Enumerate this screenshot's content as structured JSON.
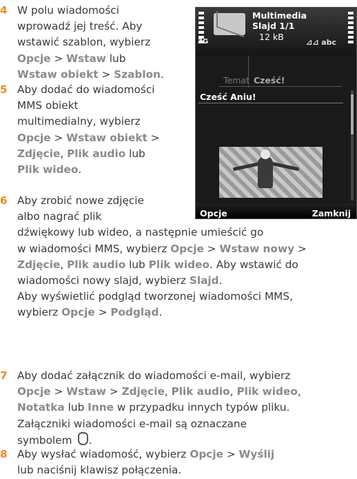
{
  "steps": [
    {
      "num": "4",
      "lines": [
        [
          "W polu wiadomości"
        ],
        [
          "wprowadź jej treść. Aby"
        ],
        [
          "wstawić szablon, wybierz"
        ],
        [
          {
            "b": "Opcje"
          },
          " > ",
          {
            "b": "Wstaw"
          },
          " lub"
        ],
        [
          {
            "b": "Wstaw obiekt"
          },
          " > ",
          {
            "b": "Szablon"
          },
          "."
        ]
      ]
    },
    {
      "num": "5",
      "lines": [
        [
          "Aby dodać do wiadomości"
        ],
        [
          "MMS obiekt"
        ],
        [
          "multimedialny, wybierz"
        ],
        [
          {
            "b": "Opcje"
          },
          " > ",
          {
            "b": "Wstaw obiekt"
          },
          " >"
        ],
        [
          {
            "b": "Zdjęcie"
          },
          ", ",
          {
            "b": "Plik audio"
          },
          " lub"
        ],
        [
          {
            "b": "Plik wideo"
          },
          "."
        ]
      ]
    },
    {
      "num": "6",
      "lines": [
        [
          "Aby zrobić nowe zdjęcie"
        ],
        [
          "albo nagrać plik"
        ],
        [
          "dźwiękowy lub wideo, a następnie umieścić go"
        ],
        [
          "w wiadomości MMS, wybierz ",
          {
            "b": "Opcje"
          },
          " > ",
          {
            "b": "Wstaw nowy"
          },
          " >"
        ],
        [
          {
            "b": "Zdjęcie"
          },
          ", ",
          {
            "b": "Plik audio"
          },
          " lub ",
          {
            "b": "Plik wideo"
          },
          ". Aby wstawić do"
        ],
        [
          "wiadomości nowy slajd, wybierz ",
          {
            "b": "Slajd"
          },
          "."
        ],
        [
          "Aby wyświetlić podgląd tworzonej wiadomości MMS,"
        ],
        [
          "wybierz ",
          {
            "b": "Opcje"
          },
          " > ",
          {
            "b": "Podgląd"
          },
          "."
        ]
      ]
    },
    {
      "num": "7",
      "lines": [
        [
          "Aby dodać załącznik do wiadomości e-mail, wybierz"
        ],
        [
          {
            "b": "Opcje"
          },
          " > ",
          {
            "b": "Wstaw"
          },
          " > ",
          {
            "b": "Zdjęcie"
          },
          ", ",
          {
            "b": "Plik audio"
          },
          ", ",
          {
            "b": "Plik wideo"
          },
          ","
        ],
        [
          {
            "b": "Notatka"
          },
          " lub ",
          {
            "b": "Inne"
          },
          " w przypadku innych typów pliku."
        ],
        [
          "Załączniki wiadomości e-mail są oznaczane"
        ],
        [
          "symbolem ",
          {
            "icon": "paperclip"
          },
          "."
        ]
      ]
    },
    {
      "num": "8",
      "lines": [
        [
          "Aby wysłać wiadomość, wybierz ",
          {
            "b": "Opcje"
          },
          " > ",
          {
            "b": "Wyślij"
          }
        ],
        [
          "lub naciśnij klawisz połączenia."
        ]
      ]
    }
  ],
  "phone": {
    "title": "Multimedia",
    "slide": "Slajd 1/1",
    "size": "12 kB",
    "network": "3G",
    "input_mode": "⊿⊿ abc",
    "subject_label": "Temat",
    "subject_value": "Cześć!",
    "body_text": "Cześć Aniu!",
    "softkey_left": "Opcje",
    "softkey_right": "Zamknij"
  }
}
